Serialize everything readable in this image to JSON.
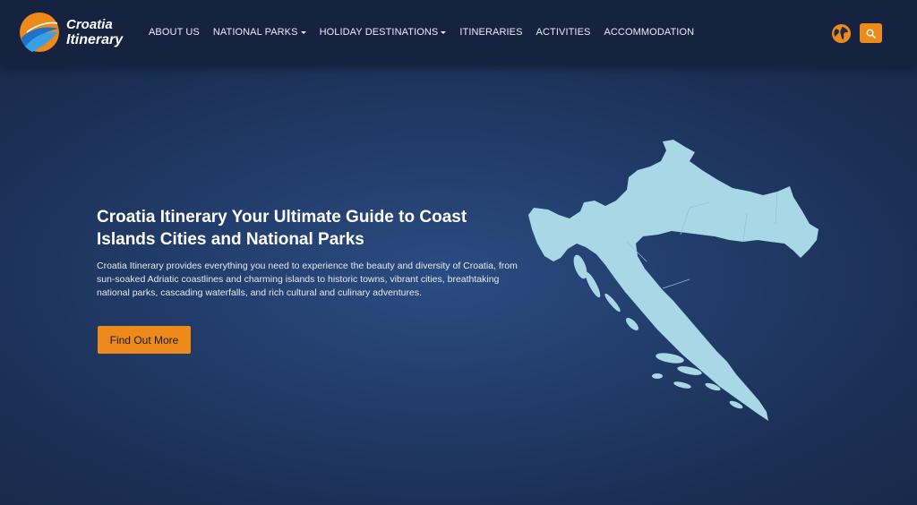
{
  "header": {
    "logo": {
      "line1": "Croatia",
      "line2": "Itinerary"
    },
    "nav": [
      {
        "label": "ABOUT US",
        "dropdown": false
      },
      {
        "label": "NATIONAL PARKS",
        "dropdown": true
      },
      {
        "label": "HOLIDAY DESTINATIONS",
        "dropdown": true
      },
      {
        "label": "ITINERARIES",
        "dropdown": false
      },
      {
        "label": "ACTIVITIES",
        "dropdown": false
      },
      {
        "label": "ACCOMMODATION",
        "dropdown": false
      }
    ],
    "icons": {
      "language": "globe-icon",
      "search": "search-icon"
    }
  },
  "hero": {
    "headline": "Croatia Itinerary Your Ultimate Guide to Coast Islands Cities and National Parks",
    "description": "Croatia Itinerary provides everything you need to experience the beauty and diversity of Croatia, from sun-soaked Adriatic coastlines and charming islands to historic towns, vibrant cities, breathtaking national parks, cascading waterfalls, and rich cultural and culinary adventures.",
    "cta_label": "Find Out More"
  },
  "colors": {
    "header_bg": "#162340",
    "hero_bg": "#223d6b",
    "accent": "#ee8a1c",
    "map_fill": "#a8d8e6"
  }
}
